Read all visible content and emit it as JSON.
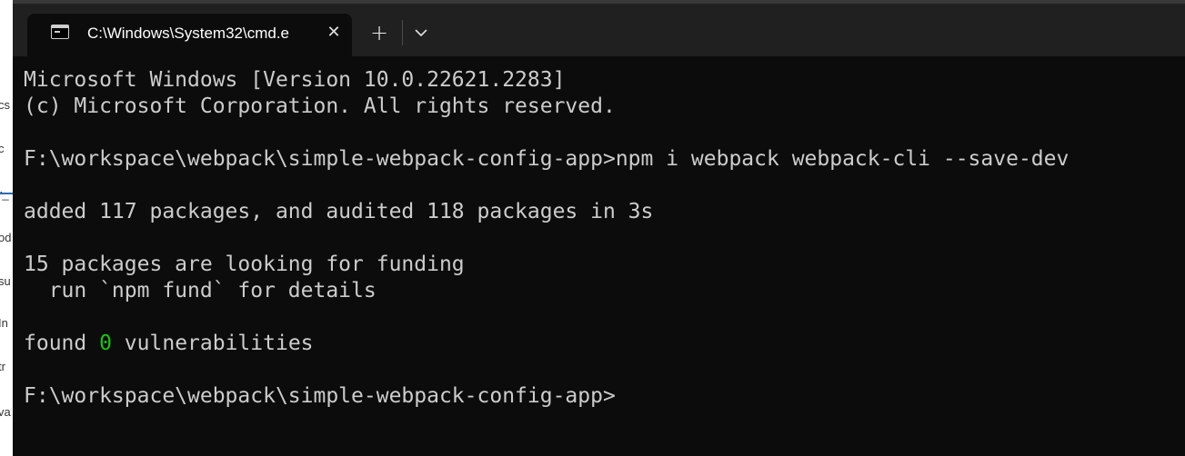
{
  "background_window": {
    "fragments": [
      "cs",
      "c",
      "r_",
      "od",
      "su",
      "In",
      "tr",
      "va"
    ]
  },
  "terminal": {
    "tab": {
      "icon": "cmd-icon",
      "title": "C:\\Windows\\System32\\cmd.e",
      "close_glyph": "✕"
    },
    "new_tab_glyph": "+",
    "dropdown_icon": "chevron-down-icon",
    "console": {
      "version_line": "Microsoft Windows [Version 10.0.22621.2283]",
      "copyright_line": "(c) Microsoft Corporation. All rights reserved.",
      "prompt_1": "F:\\workspace\\webpack\\simple-webpack-config-app>",
      "command_1": "npm i webpack webpack-cli --save-dev",
      "added_line": "added 117 packages, and audited 118 packages in 3s",
      "funding_line": "15 packages are looking for funding",
      "fund_hint_line": "  run `npm fund` for details",
      "found_prefix": "found ",
      "vuln_count": "0",
      "vuln_suffix": " vulnerabilities",
      "prompt_2": "F:\\workspace\\webpack\\simple-webpack-config-app>"
    }
  },
  "colors": {
    "console_bg": "#0c0c0c",
    "titlebar_bg": "#202020",
    "text": "#cccccc",
    "success_green": "#16c60c"
  }
}
